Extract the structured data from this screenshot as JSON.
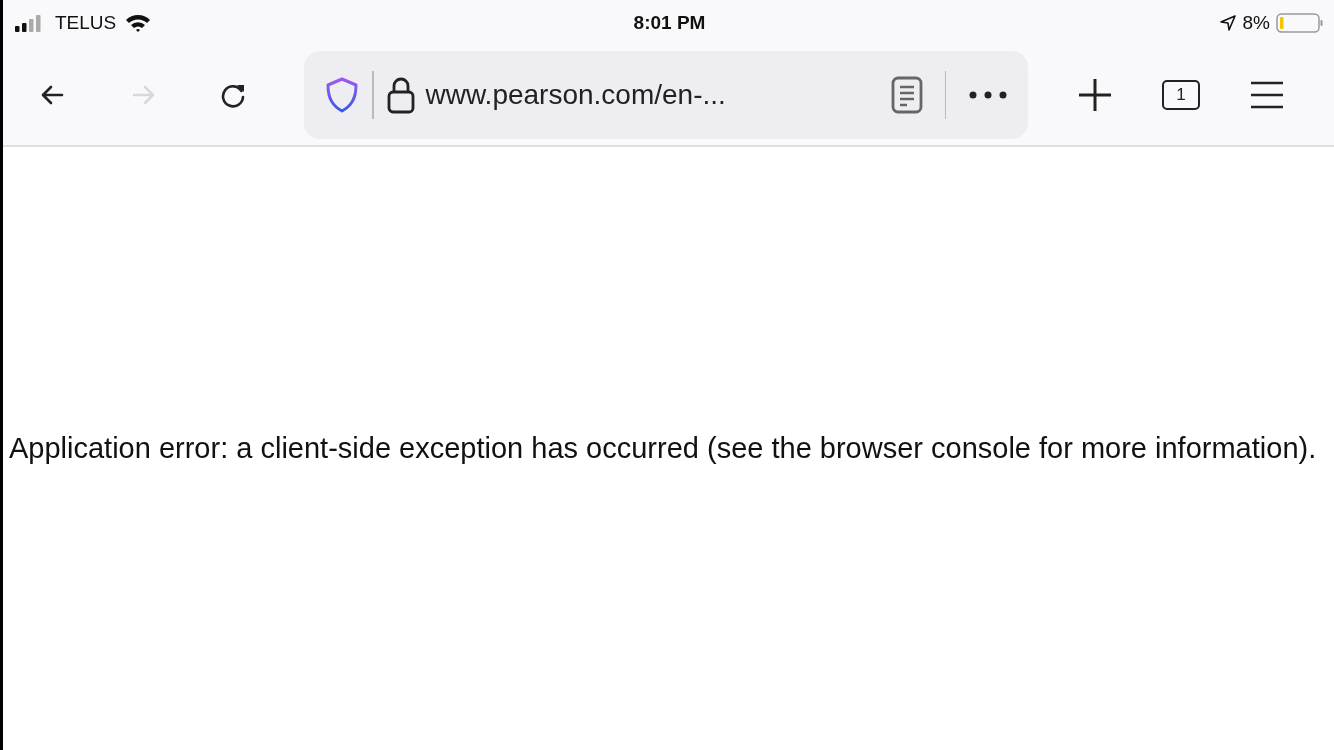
{
  "status_bar": {
    "carrier": "TELUS",
    "time": "8:01 PM",
    "battery_percent": "8%"
  },
  "toolbar": {
    "nav_buttons": [
      {
        "kind": "back",
        "disabled": false
      },
      {
        "kind": "forward",
        "disabled": true
      },
      {
        "kind": "reload",
        "disabled": false
      }
    ],
    "url": "www.pearson.com/en-...",
    "tab_count": "1"
  },
  "page": {
    "message": "Application error: a client-side exception has occurred (see the browser console for more information)."
  }
}
